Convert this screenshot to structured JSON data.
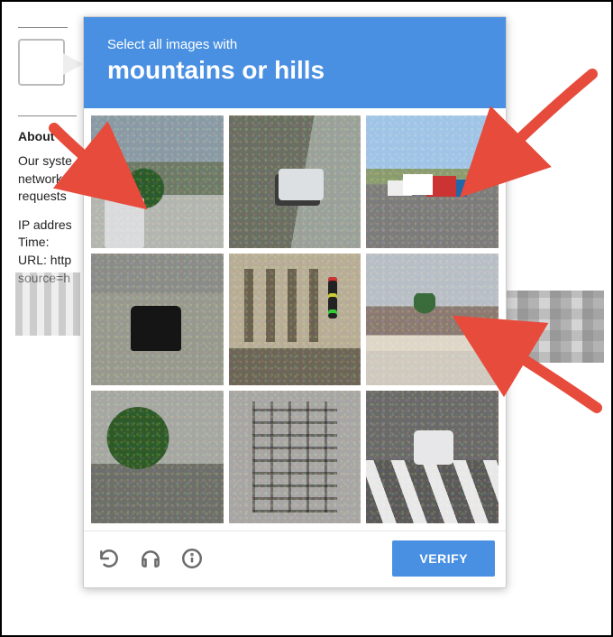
{
  "background": {
    "heading": "About th",
    "paragraph1_line1": "Our syste",
    "paragraph1_line2": "network.",
    "paragraph1_line3": "requests",
    "info_ip": "IP addres",
    "info_time": "Time:",
    "info_url": "URL: http",
    "info_source": "source=h"
  },
  "captcha": {
    "header_pre": "Select all images with",
    "header_main": "mountains or hills",
    "verify_label": "VERIFY",
    "tiles": [
      {
        "alt": "palm tree against cloudy hills with truck"
      },
      {
        "alt": "white car driving on road"
      },
      {
        "alt": "highway with trucks and green hills in distance"
      },
      {
        "alt": "black car seen from behind on grey street"
      },
      {
        "alt": "brick building corner with traffic light"
      },
      {
        "alt": "palm tree with brown mountain ridge and awning roof"
      },
      {
        "alt": "green tree foliage over road"
      },
      {
        "alt": "building wall with metal fire escape stairs"
      },
      {
        "alt": "white car on street with zebra crosswalk"
      }
    ]
  },
  "annotations": {
    "arrow_count": 3,
    "arrow_color": "#e64b3c"
  }
}
